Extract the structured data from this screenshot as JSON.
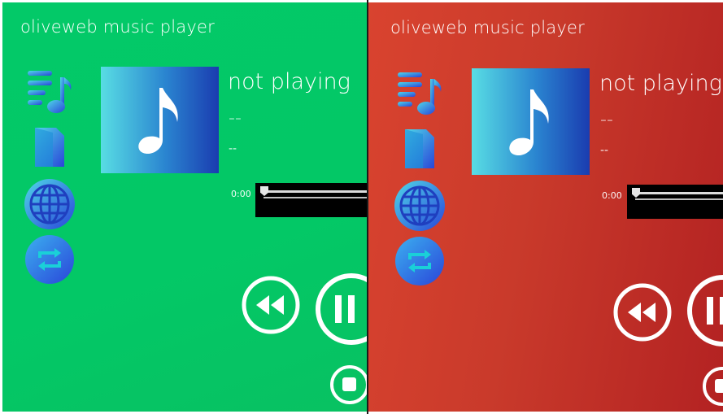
{
  "windows": [
    {
      "theme": "green",
      "background": "#03c968",
      "app_title": "oliveweb music player",
      "now_playing": {
        "title": "not playing",
        "artist": "--",
        "album": "--"
      },
      "seek": {
        "time": "0:00",
        "progress": 0.0
      },
      "nav_icons": [
        "playlist-icon",
        "library-icon",
        "globe-icon",
        "repeat-icon"
      ],
      "controls": [
        "rewind-button",
        "pause-button",
        "stop-button"
      ]
    },
    {
      "theme": "red",
      "background": "#c93a2b",
      "app_title": "oliveweb music player",
      "now_playing": {
        "title": "not playing",
        "artist": "--",
        "album": "--"
      },
      "seek": {
        "time": "0:00",
        "progress": 0.0
      },
      "nav_icons": [
        "playlist-icon",
        "library-icon",
        "globe-icon",
        "repeat-icon"
      ],
      "controls": [
        "rewind-button",
        "pause-button",
        "stop-button"
      ]
    }
  ],
  "colors": {
    "icon_gradient_start": "#4fd7e8",
    "icon_gradient_end": "#2a45d9",
    "seek_background": "#000000",
    "text": "#ffffff"
  }
}
